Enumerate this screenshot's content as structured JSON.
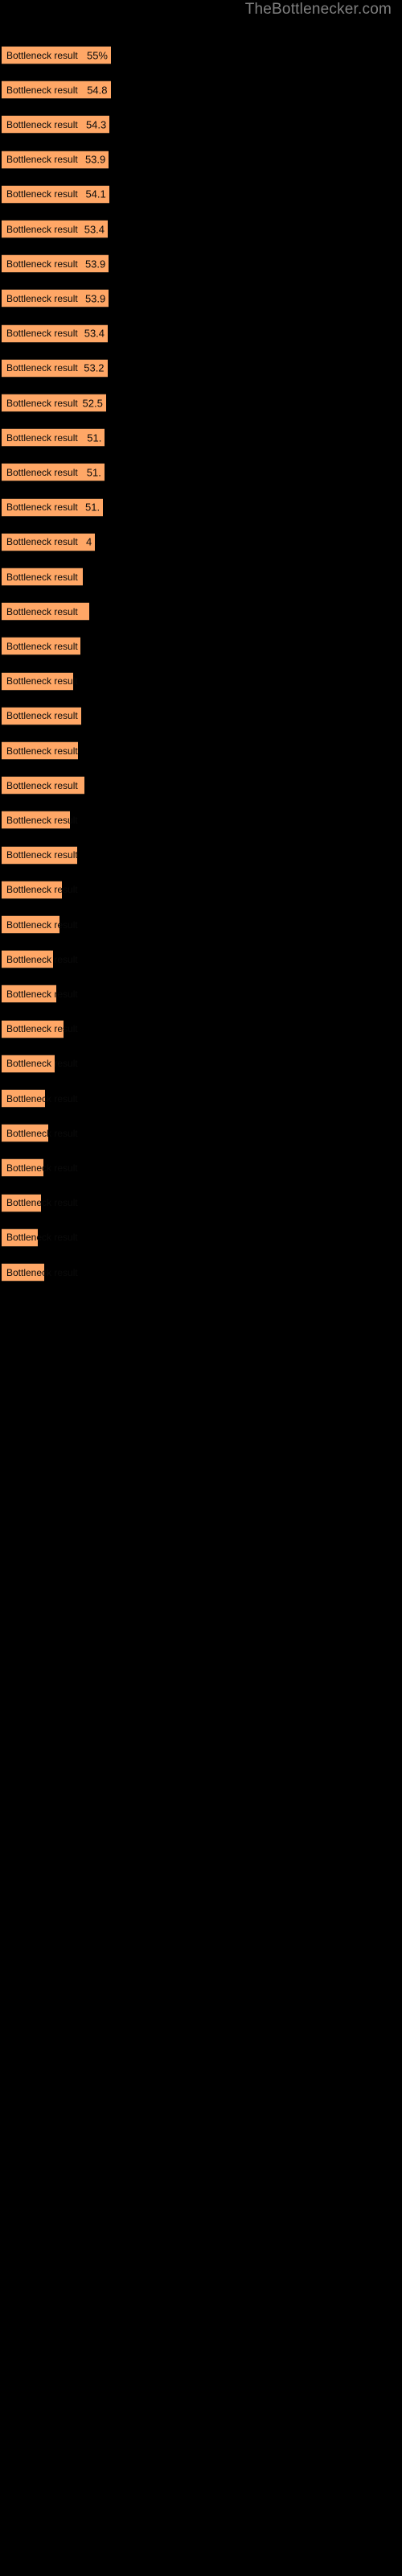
{
  "page": {
    "background_color": "#000000",
    "watermark": "TheBottlenecker.com",
    "watermark_color": "#808080"
  },
  "chart_data": {
    "type": "bar",
    "orientation": "horizontal",
    "title": "TheBottlenecker.com",
    "xlabel": "",
    "ylabel": "",
    "grid": false,
    "legend": "none",
    "bar_color": "#FFA766",
    "background_color": "#000000",
    "text_color": "#0a0a0a",
    "xlim": [
      0,
      55
    ],
    "value_suffix": "%",
    "categories": [
      "Bottleneck result",
      "Bottleneck result",
      "Bottleneck result",
      "Bottleneck result",
      "Bottleneck result",
      "Bottleneck result",
      "Bottleneck result",
      "Bottleneck result",
      "Bottleneck result",
      "Bottleneck result",
      "Bottleneck result",
      "Bottleneck result",
      "Bottleneck result",
      "Bottleneck result",
      "Bottleneck result",
      "Bottleneck result",
      "Bottleneck result",
      "Bottleneck result",
      "Bottleneck result",
      "Bottleneck result",
      "Bottleneck result",
      "Bottleneck result",
      "Bottleneck result",
      "Bottleneck result",
      "Bottleneck result",
      "Bottleneck result",
      "Bottleneck result",
      "Bottleneck result",
      "Bottleneck result",
      "Bottleneck result",
      "Bottleneck result",
      "Bottleneck result",
      "Bottleneck result",
      "Bottleneck result",
      "Bottleneck result",
      "Bottleneck result"
    ],
    "values": [
      55.0,
      54.8,
      54.3,
      53.9,
      54.1,
      53.4,
      53.9,
      53.9,
      53.4,
      53.2,
      52.5,
      51.9,
      51.7,
      51.0,
      47.0,
      41.0,
      44.0,
      39.5,
      36.0,
      40.0,
      38.5,
      41.5,
      34.5,
      38.0,
      30.5,
      29.0,
      26.0,
      27.5,
      31.0,
      26.5,
      22.0,
      23.5,
      21.0,
      20.0,
      18.0,
      21.5
    ],
    "value_labels": [
      "55%",
      "54.8",
      "54.3",
      "53.9",
      "54.1",
      "53.4",
      "53.9",
      "53.9",
      "53.4",
      "53.2",
      "52.5",
      "51.",
      "51.",
      "51.",
      "4",
      "",
      "",
      "",
      "",
      "",
      "",
      "",
      "",
      "",
      "",
      "",
      "",
      "",
      "",
      "",
      "",
      "",
      "",
      "",
      "",
      ""
    ]
  }
}
